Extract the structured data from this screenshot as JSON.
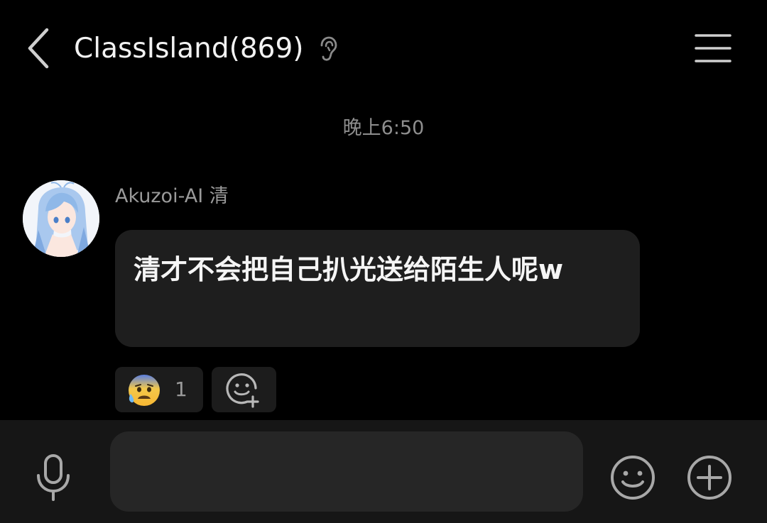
{
  "header": {
    "title": "ClassIsland(869)",
    "icons": {
      "back": "chevron-left-icon",
      "ear": "ear-icon",
      "menu": "hamburger-menu-icon"
    }
  },
  "timestamp": "晚上6:50",
  "message": {
    "sender": "Akuzoi-AI 清",
    "text": "清才不会把自己扒光送给陌生人呢w",
    "avatar": "anime-girl-avatar"
  },
  "reactions": [
    {
      "emoji": "anxious-face-with-sweat",
      "count": "1"
    }
  ],
  "input_bar": {
    "value": "",
    "placeholder": "",
    "icons": {
      "voice": "microphone-icon",
      "emoji": "smiley-icon",
      "more": "plus-circle-icon"
    }
  },
  "colors": {
    "background": "#000000",
    "bubble": "#1e1e1e",
    "input_bar": "#161616",
    "secondary_text": "#8e8e8e"
  }
}
